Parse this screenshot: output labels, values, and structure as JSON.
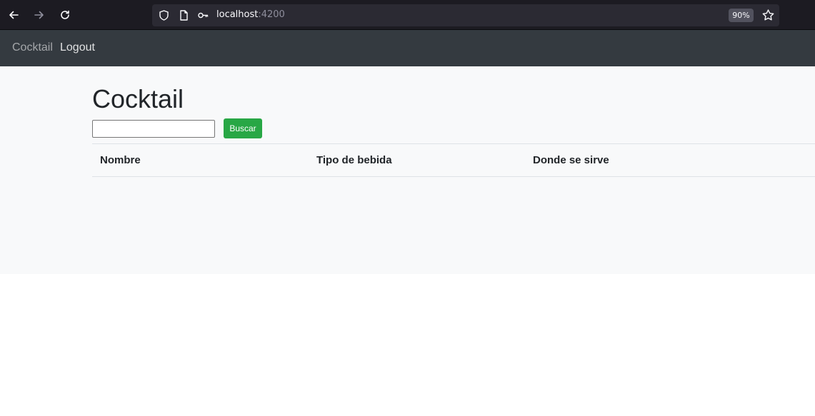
{
  "browser": {
    "url_host": "localhost",
    "url_port": ":4200",
    "zoom": "90%",
    "icons": [
      "back-icon",
      "forward-icon",
      "reload-icon",
      "shield-icon",
      "page-icon",
      "key-icon",
      "star-icon"
    ]
  },
  "navbar": {
    "brand": "Cocktail",
    "logout": "Logout"
  },
  "main": {
    "title": "Cocktail",
    "search": {
      "value": "",
      "placeholder": ""
    },
    "search_button": "Buscar",
    "table": {
      "headers": [
        "Nombre",
        "Tipo de bebida",
        "Donde se sirve"
      ],
      "rows": []
    }
  },
  "colors": {
    "navbar_bg": "#343a40",
    "main_bg": "#f8f9fa",
    "button_green": "#28a745"
  }
}
